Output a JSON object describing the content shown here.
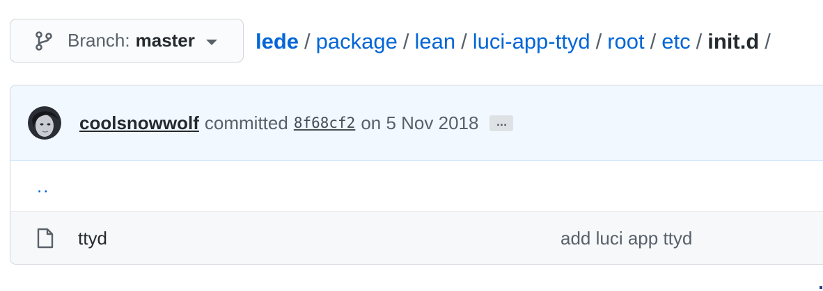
{
  "branch": {
    "label": "Branch:",
    "name": "master",
    "icon": "git-branch-icon"
  },
  "breadcrumb": {
    "root": "lede",
    "segments": [
      "package",
      "lean",
      "luci-app-ttyd",
      "root",
      "etc"
    ],
    "current": "init.d",
    "separator": "/"
  },
  "commit": {
    "author": "coolsnowwolf",
    "verb": "committed",
    "sha": "8f68cf2",
    "date": "on 5 Nov 2018",
    "more_label": "…"
  },
  "files": {
    "parent_link": "..",
    "rows": [
      {
        "name": "ttyd",
        "icon": "file-icon",
        "message": "add luci app ttyd"
      }
    ]
  },
  "colors": {
    "link": "#0366d6",
    "commit_bar_bg": "#f1f8ff",
    "row_bg": "#f6f8fa",
    "border": "#d1d5da"
  }
}
